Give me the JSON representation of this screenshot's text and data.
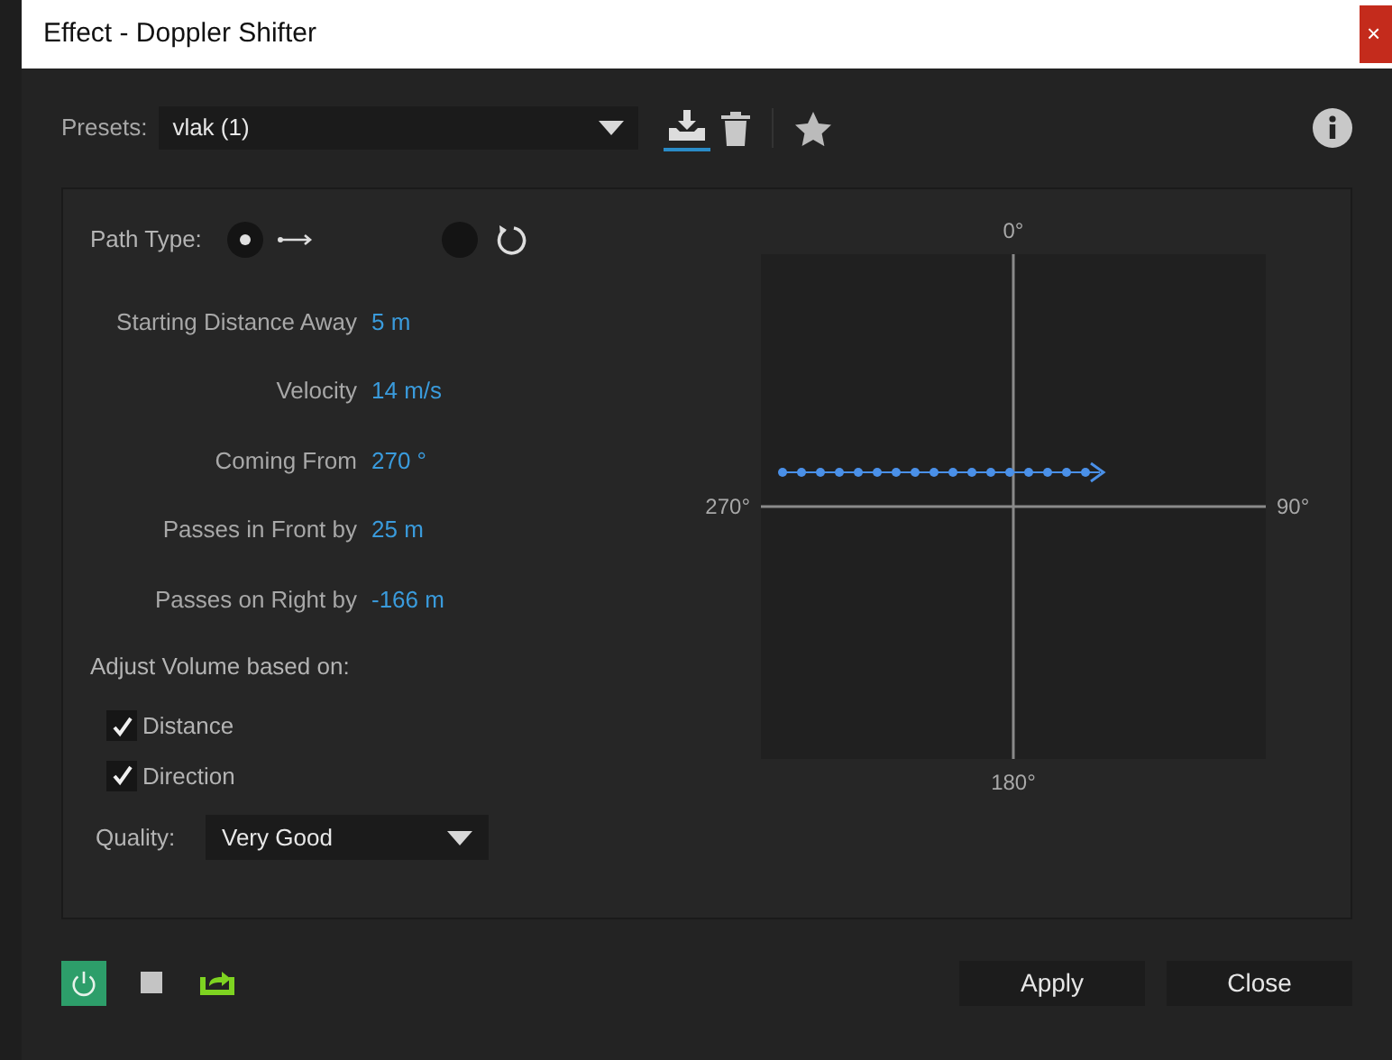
{
  "window": {
    "title": "Effect - Doppler Shifter",
    "close": "×"
  },
  "presets": {
    "label": "Presets:",
    "value": "vlak (1)"
  },
  "path_type": {
    "label": "Path Type:",
    "options": [
      {
        "kind": "straight",
        "selected": true
      },
      {
        "kind": "circular",
        "selected": false
      }
    ]
  },
  "fields": [
    {
      "label": "Starting Distance Away",
      "value": "5 m"
    },
    {
      "label": "Velocity",
      "value": "14 m/s"
    },
    {
      "label": "Coming From",
      "value": "270 °"
    },
    {
      "label": "Passes in Front by",
      "value": "25 m"
    },
    {
      "label": "Passes on Right by",
      "value": "-166 m"
    }
  ],
  "volume": {
    "label": "Adjust Volume based on:",
    "options": [
      {
        "label": "Distance",
        "checked": true
      },
      {
        "label": "Direction",
        "checked": true
      }
    ]
  },
  "quality": {
    "label": "Quality:",
    "value": "Very Good"
  },
  "compass": {
    "top": "0°",
    "left": "270°",
    "right": "90°",
    "bottom": "180°"
  },
  "power": {
    "on": true
  },
  "buttons": [
    "Apply",
    "Close"
  ]
}
